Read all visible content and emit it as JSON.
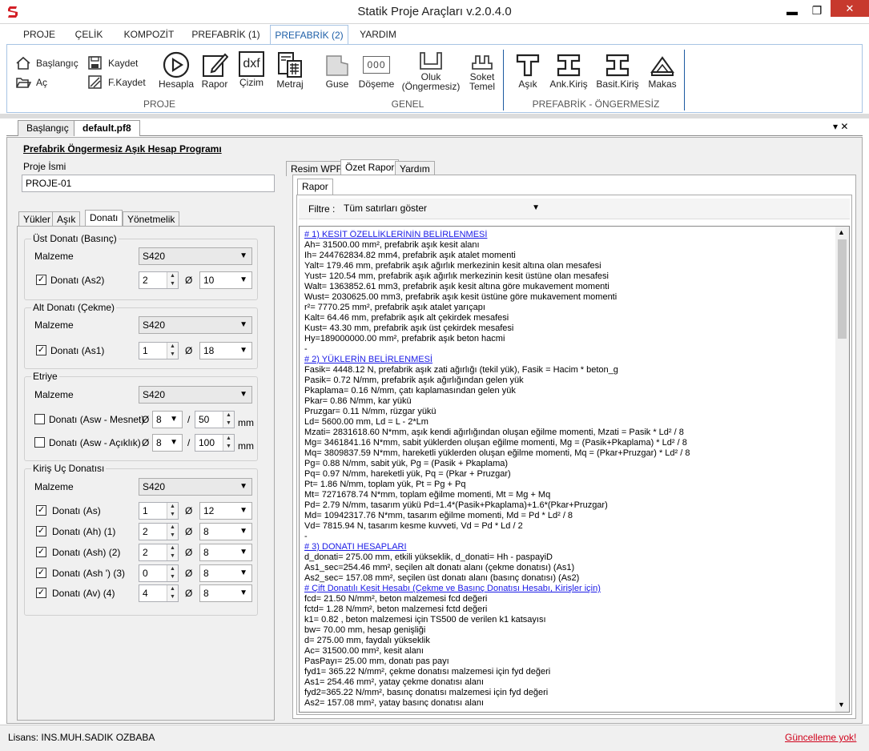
{
  "window": {
    "title": "Statik Proje Araçları v.2.0.4.0",
    "minimize": "▬",
    "maximize": "❐",
    "close": "✕"
  },
  "menu": [
    "PROJE",
    "ÇELİK",
    "KOMPOZİT",
    "PREFABRİK (1)",
    "PREFABRİK (2)",
    "YARDIM"
  ],
  "ribbon": {
    "proje": {
      "baslangic": "Başlangıç",
      "ac": "Aç",
      "kaydet": "Kaydet",
      "fkaydet": "F.Kaydet",
      "hesapla": "Hesapla",
      "rapor": "Rapor",
      "cizim": "Çizim",
      "metraj": "Metraj",
      "group": "PROJE"
    },
    "genel": {
      "guse": "Guse",
      "doseme": "Döşeme",
      "oluk_1": "Oluk",
      "oluk_2": "(Öngermesiz)",
      "soket_1": "Soket",
      "soket_2": "Temel",
      "group": "GENEL",
      "doseme_icon_text": "000"
    },
    "prefabrik": {
      "asik": "Aşık",
      "ank": "Ank.Kiriş",
      "basit": "Basit.Kiriş",
      "makas": "Makas",
      "group": "PREFABRİK - ÖNGERMESİZ"
    },
    "dxf": "dxf"
  },
  "doctabs": [
    "Başlangıç",
    "default.pf8"
  ],
  "doctab_controls": "▾ ✕",
  "program_title": "Prefabrik Öngermesiz Aşık Hesap Programı",
  "proje_ismi": {
    "label": "Proje İsmi",
    "value": "PROJE-01"
  },
  "left_tabs": [
    "Yükler",
    "Aşık",
    "Donatı",
    "Yönetmelik"
  ],
  "ust_donati": {
    "title": "Üst Donatı (Basınç)",
    "malzeme_label": "Malzeme",
    "malzeme": "S420",
    "donati_label": "Donatı (As2)",
    "count": "2",
    "phi": "Ø",
    "dia": "10"
  },
  "alt_donati": {
    "title": "Alt Donatı (Çekme)",
    "malzeme_label": "Malzeme",
    "malzeme": "S420",
    "donati_label": "Donatı (As1)",
    "count": "1",
    "phi": "Ø",
    "dia": "18"
  },
  "etriye": {
    "title": "Etriye",
    "malzeme_label": "Malzeme",
    "malzeme": "S420",
    "mesnet_label": "Donatı (Asw - Mesnet)",
    "mesnet_dia": "8",
    "mesnet_spacing": "50",
    "aciklik_label": "Donatı (Asw - Açıklık)",
    "aciklik_dia": "8",
    "aciklik_spacing": "100",
    "phi": "Ø",
    "slash": "/",
    "unit": "mm"
  },
  "kiris_uc": {
    "title": "Kiriş Uç Donatısı",
    "malzeme_label": "Malzeme",
    "malzeme": "S420",
    "phi": "Ø",
    "rows": [
      {
        "label": "Donatı (As)",
        "count": "1",
        "dia": "12"
      },
      {
        "label": "Donatı (Ah) (1)",
        "count": "2",
        "dia": "8"
      },
      {
        "label": "Donatı (Ash) (2)",
        "count": "2",
        "dia": "8"
      },
      {
        "label": "Donatı (Ash ') (3)",
        "count": "0",
        "dia": "8"
      },
      {
        "label": "Donatı (Av) (4)",
        "count": "4",
        "dia": "8"
      }
    ]
  },
  "right_tabs": [
    "Resim WPF",
    "Özet Rapor",
    "Yardım"
  ],
  "rapor_tab": "Rapor",
  "filter": {
    "label": "Filtre :",
    "value": "Tüm satırları göster"
  },
  "report_lines": [
    {
      "t": "# 1) KESİT ÖZELLİKLERİNİN BELİRLENMESİ",
      "h": true
    },
    {
      "t": "Ah= 31500.00 mm², prefabrik aşık kesit alanı"
    },
    {
      "t": "Ih= 244762834.82 mm4, prefabrik aşık atalet momenti"
    },
    {
      "t": "Yalt= 179.46 mm, prefabrik aşık ağırlık merkezinin kesit altına olan mesafesi"
    },
    {
      "t": "Yust= 120.54 mm, prefabrik aşık ağırlık merkezinin kesit üstüne olan mesafesi"
    },
    {
      "t": "Walt= 1363852.61 mm3, prefabrik aşık kesit altına göre mukavement momenti"
    },
    {
      "t": "Wust= 2030625.00 mm3, prefabrik aşık kesit üstüne göre mukavement momenti"
    },
    {
      "t": "r²= 7770.25 mm², prefabrik aşık atalet yarıçapı"
    },
    {
      "t": "Kalt= 64.46 mm, prefabrik aşık alt çekirdek mesafesi"
    },
    {
      "t": "Kust= 43.30 mm, prefabrik aşık üst çekirdek mesafesi"
    },
    {
      "t": "Hy=189000000.00 mm², prefabrik aşık beton hacmi"
    },
    {
      "t": "-"
    },
    {
      "t": "# 2) YÜKLERİN BELİRLENMESİ",
      "h": true
    },
    {
      "t": "Fasik= 4448.12 N, prefabrik aşık zati ağırlığı (tekil yük), Fasik = Hacim * beton_g"
    },
    {
      "t": "Pasik= 0.72 N/mm, prefabrik aşık ağırlığından gelen yük"
    },
    {
      "t": "Pkaplama= 0.16 N/mm, çatı kaplamasından gelen yük"
    },
    {
      "t": "Pkar= 0.86 N/mm, kar yükü"
    },
    {
      "t": "Pruzgar= 0.11 N/mm, rüzgar yükü"
    },
    {
      "t": "Ld= 5600.00 mm, Ld = L - 2*Lm"
    },
    {
      "t": "Mzati= 2831618.60 N*mm, aşık kendi ağırlığından oluşan eğilme momenti, Mzati = Pasik * Ld² / 8"
    },
    {
      "t": "Mg= 3461841.16 N*mm, sabit yüklerden oluşan eğilme momenti, Mg = (Pasik+Pkaplama) * Ld² / 8"
    },
    {
      "t": "Mq= 3809837.59 N*mm, hareketli yüklerden oluşan eğilme momenti, Mq = (Pkar+Pruzgar) * Ld² / 8"
    },
    {
      "t": "Pg= 0.88 N/mm, sabit yük, Pg = (Pasik + Pkaplama)"
    },
    {
      "t": "Pq= 0.97 N/mm, hareketli yük, Pq = (Pkar + Pruzgar)"
    },
    {
      "t": "Pt= 1.86 N/mm, toplam yük, Pt = Pg + Pq"
    },
    {
      "t": "Mt= 7271678.74 N*mm, toplam eğilme momenti, Mt = Mg + Mq"
    },
    {
      "t": "Pd= 2.79 N/mm, tasarım yükü Pd=1.4*(Pasik+Pkaplama)+1.6*(Pkar+Pruzgar)"
    },
    {
      "t": "Md= 10942317.76 N*mm, tasarım eğilme momenti, Md = Pd * Ld² / 8"
    },
    {
      "t": "Vd= 7815.94 N, tasarım kesme kuvveti, Vd = Pd * Ld / 2"
    },
    {
      "t": "-"
    },
    {
      "t": "# 3) DONATI HESAPLARI",
      "h": true
    },
    {
      "t": "d_donati= 275.00 mm, etkili yükseklik, d_donati= Hh - paspayiD"
    },
    {
      "t": "As1_sec=254.46 mm², seçilen alt donatı alanı (çekme donatısı) (As1)"
    },
    {
      "t": "As2_sec= 157.08 mm², seçilen üst donatı alanı (basınç donatısı) (As2)"
    },
    {
      "t": "# Çift Donatılı Kesit Hesabı (Çekme ve Basınç Donatısı Hesabı, Kirişler için)",
      "h": true
    },
    {
      "t": "fcd= 21.50 N/mm², beton malzemesi fcd değeri"
    },
    {
      "t": "fctd= 1.28 N/mm², beton malzemesi fctd değeri"
    },
    {
      "t": "k1= 0.82 , beton malzemesi için TS500 de verilen k1 katsayısı"
    },
    {
      "t": "bw= 70.00 mm, hesap genişliği"
    },
    {
      "t": "d= 275.00 mm, faydalı yükseklik"
    },
    {
      "t": "Ac= 31500.00 mm², kesit alanı"
    },
    {
      "t": "PasPayı= 25.00 mm, donatı pas payı"
    },
    {
      "t": "fyd1= 365.22 N/mm², çekme donatısı malzemesi için fyd değeri"
    },
    {
      "t": "As1= 254.46 mm², yatay çekme donatısı alanı"
    },
    {
      "t": "fyd2=365.22 N/mm², basınç donatısı malzemesi için fyd değeri"
    },
    {
      "t": "As2= 157.08 mm², yatay basınç donatısı alanı"
    }
  ],
  "status": {
    "license": "Lisans: INS.MUH.SADIK OZBABA",
    "update": "Güncelleme yok!"
  },
  "colors": {
    "accent": "#1e5fa8",
    "close": "#c7392d",
    "link_red": "#d0021b",
    "report_head": "#1a1ae6"
  }
}
